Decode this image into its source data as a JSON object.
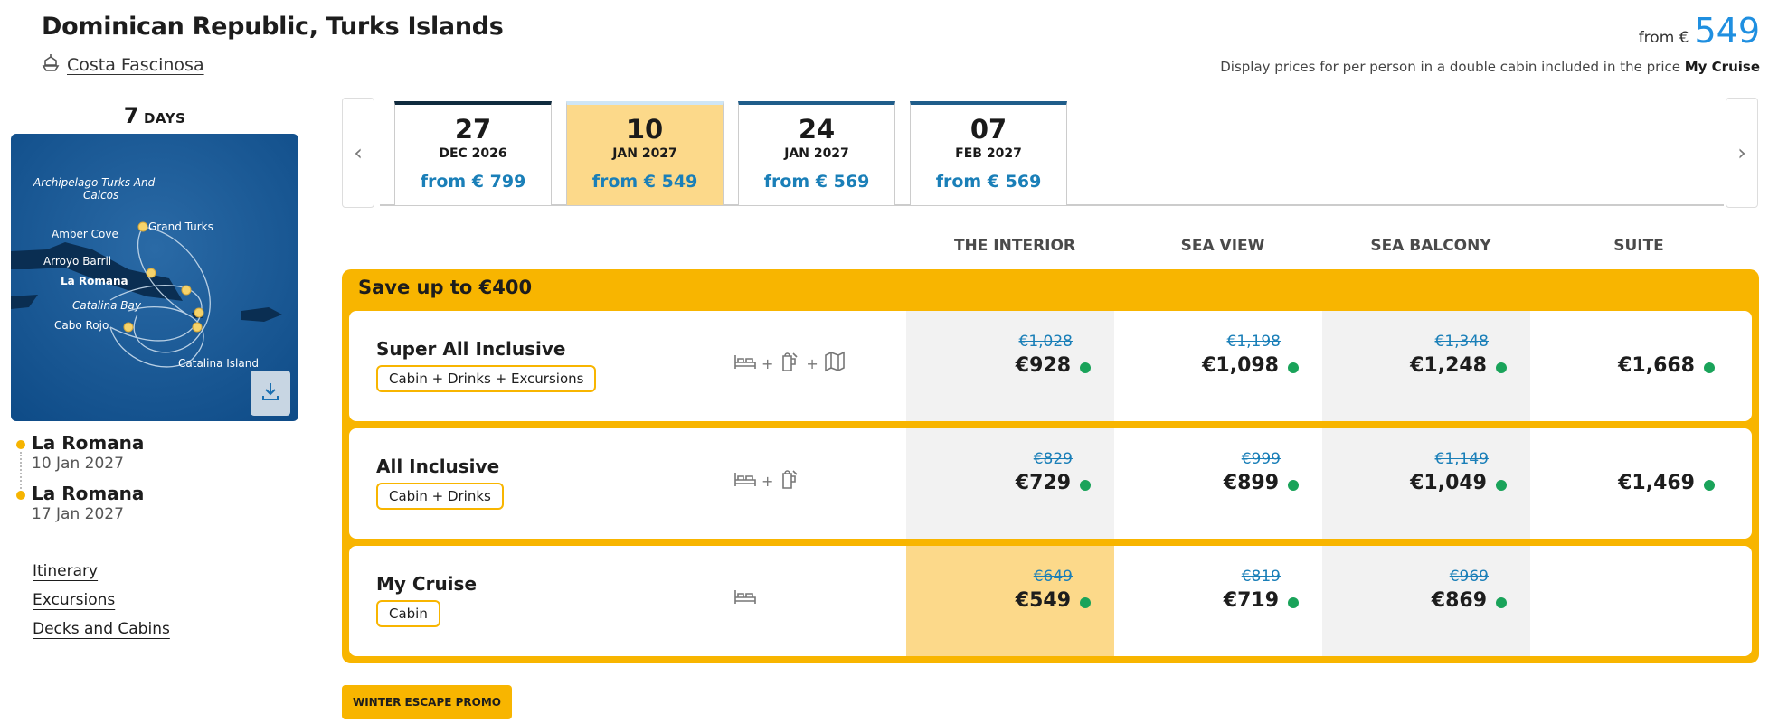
{
  "header": {
    "title": "Dominican Republic, Turks Islands",
    "ship": "Costa Fascinosa",
    "from_label": "from €",
    "from_price": "549",
    "note_prefix": "Display prices for per person in a double cabin included in the price ",
    "note_bold": "My Cruise"
  },
  "duration": {
    "number": "7",
    "unit": "DAYS"
  },
  "map": {
    "labels": [
      "Archipelago Turks And",
      "Caicos",
      "Grand Turks",
      "Amber Cove",
      "Arroyo Barril",
      "La Romana",
      "Catalina Bay",
      "Cabo Rojo",
      "Catalina Island"
    ]
  },
  "itinerary": [
    {
      "port": "La Romana",
      "date": "10 Jan 2027"
    },
    {
      "port": "La Romana",
      "date": "17 Jan 2027"
    }
  ],
  "links": [
    "Itinerary",
    "Excursions",
    "Decks and Cabins"
  ],
  "dates": [
    {
      "day": "27",
      "month": "DEC 2026",
      "price": "from € 799"
    },
    {
      "day": "10",
      "month": "JAN 2027",
      "price": "from € 549"
    },
    {
      "day": "24",
      "month": "JAN 2027",
      "price": "from € 569"
    },
    {
      "day": "07",
      "month": "FEB 2027",
      "price": "from € 569"
    }
  ],
  "columns": [
    "THE INTERIOR",
    "SEA VIEW",
    "SEA BALCONY",
    "SUITE"
  ],
  "promo_title": "Save up to €400",
  "rows": [
    {
      "name": "Super All Inclusive",
      "tag": "Cabin + Drinks + Excursions",
      "prices": [
        {
          "old": "€1,028",
          "new": "€928"
        },
        {
          "old": "€1,198",
          "new": "€1,098"
        },
        {
          "old": "€1,348",
          "new": "€1,248"
        },
        {
          "old": "",
          "new": "€1,668"
        }
      ]
    },
    {
      "name": "All Inclusive",
      "tag": "Cabin + Drinks",
      "prices": [
        {
          "old": "€829",
          "new": "€729"
        },
        {
          "old": "€999",
          "new": "€899"
        },
        {
          "old": "€1,149",
          "new": "€1,049"
        },
        {
          "old": "",
          "new": "€1,469"
        }
      ]
    },
    {
      "name": "My Cruise",
      "tag": "Cabin",
      "prices": [
        {
          "old": "€649",
          "new": "€549"
        },
        {
          "old": "€819",
          "new": "€719"
        },
        {
          "old": "€969",
          "new": "€869"
        }
      ]
    }
  ],
  "icons": {
    "plus": "+"
  },
  "promo_button": "WINTER ESCAPE PROMO"
}
